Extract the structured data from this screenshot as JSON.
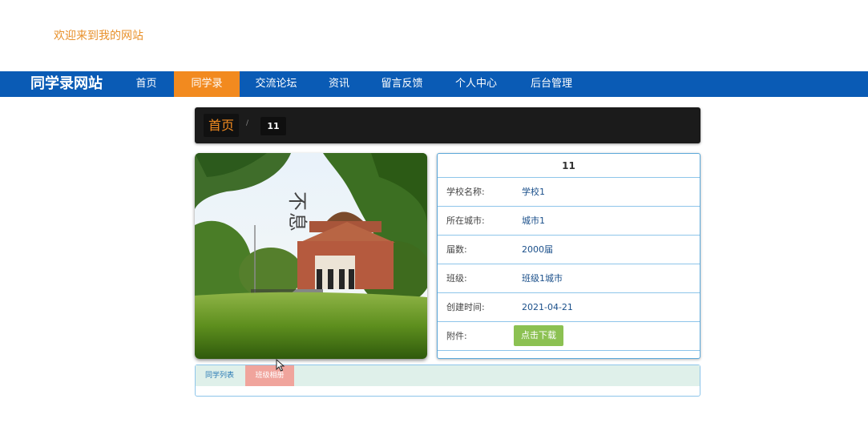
{
  "header": {
    "welcome_text": "欢迎来到我的网站"
  },
  "nav": {
    "brand": "同学录网站",
    "items": [
      {
        "label": "首页",
        "active": false
      },
      {
        "label": "同学录",
        "active": true
      },
      {
        "label": "交流论坛",
        "active": false
      },
      {
        "label": "资讯",
        "active": false
      },
      {
        "label": "留言反馈",
        "active": false
      },
      {
        "label": "个人中心",
        "active": false
      },
      {
        "label": "后台管理",
        "active": false
      }
    ]
  },
  "breadcrumb": {
    "home": "首页",
    "separator": "/",
    "current": "11"
  },
  "detail": {
    "title": "11",
    "rows": [
      {
        "label": "学校名称:",
        "value": "学校1"
      },
      {
        "label": "所在城市:",
        "value": "城市1"
      },
      {
        "label": "届数:",
        "value": "2000届"
      },
      {
        "label": "班级:",
        "value": "班级1城市"
      },
      {
        "label": "创建时间:",
        "value": "2021-04-21"
      }
    ],
    "attachment_label": "附件:",
    "download_label": "点击下载"
  },
  "tabs": [
    {
      "label": "同学列表",
      "active": false
    },
    {
      "label": "班级相册",
      "active": true
    }
  ],
  "colors": {
    "nav_bg": "#0a5bb5",
    "nav_active": "#f28a1f",
    "welcome": "#e8912c",
    "download": "#8cc152",
    "tab_active": "#f0a49c"
  }
}
